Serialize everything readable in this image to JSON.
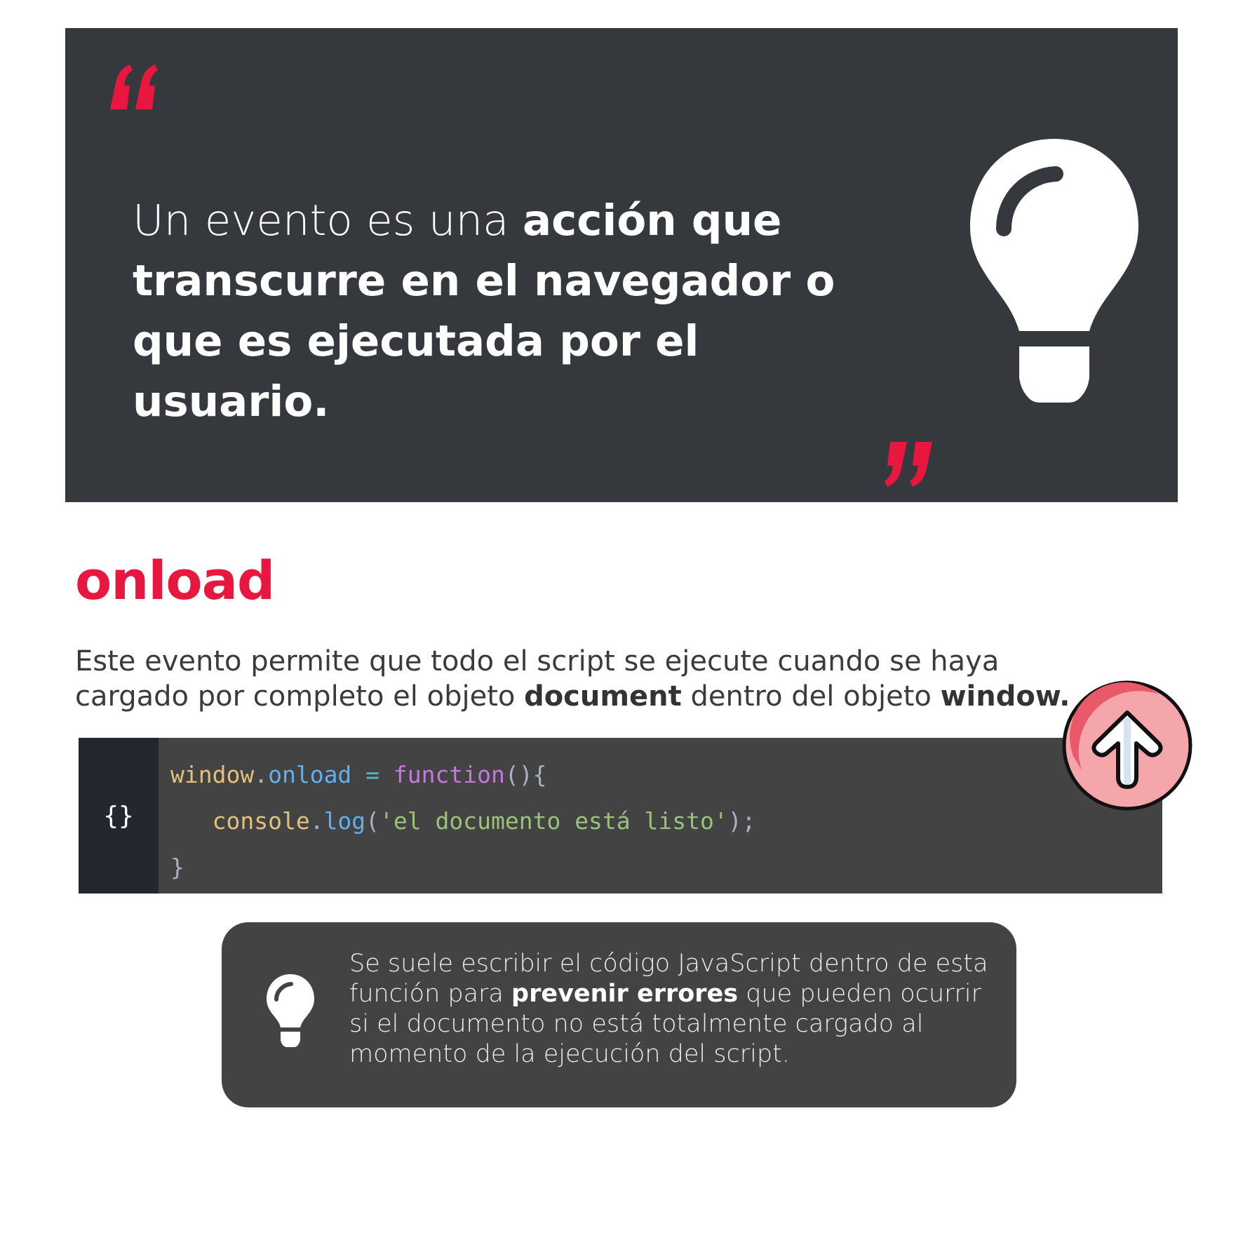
{
  "quote": {
    "text_normal": "Un evento es una ",
    "text_bold": "acción que transcurre en el navegador o que es ejecutada por el usuario.",
    "open_icon": "quote-open-icon",
    "close_icon": "quote-close-icon",
    "illustration": "lightbulb-icon"
  },
  "section": {
    "title": "onload",
    "intro_part1": "Este evento permite que todo el script se ejecute cuando se haya cargado por completo el objeto ",
    "intro_bold1": "document",
    "intro_part2": " dentro del objeto ",
    "intro_bold2": "window."
  },
  "code": {
    "gutter_label": "{}",
    "line1": {
      "obj": "window",
      "dot": ".",
      "prop": "onload",
      "op": " = ",
      "kw": "function",
      "punc": "(){"
    },
    "line2": {
      "indent": "   ",
      "obj": "console",
      "dot": ".",
      "prop": "log",
      "open": "(",
      "str": "'el documento está listo'",
      "close": ");"
    },
    "line3": "}"
  },
  "scroll_up": {
    "icon": "arrow-up-icon"
  },
  "tip": {
    "icon": "lightbulb-icon",
    "part1": "Se suele escribir el código JavaScript dentro de esta función para ",
    "bold": "prevenir errores",
    "part2": " que pueden ocurrir si el documento no está totalmente cargado al momento de la ejecución del script."
  },
  "colors": {
    "banner_bg": "#35383c",
    "accent": "#e8173f",
    "code_bg": "#434343",
    "gutter_bg": "#252730",
    "tip_bg": "#434343",
    "button_fill": "#f4a6ab"
  }
}
